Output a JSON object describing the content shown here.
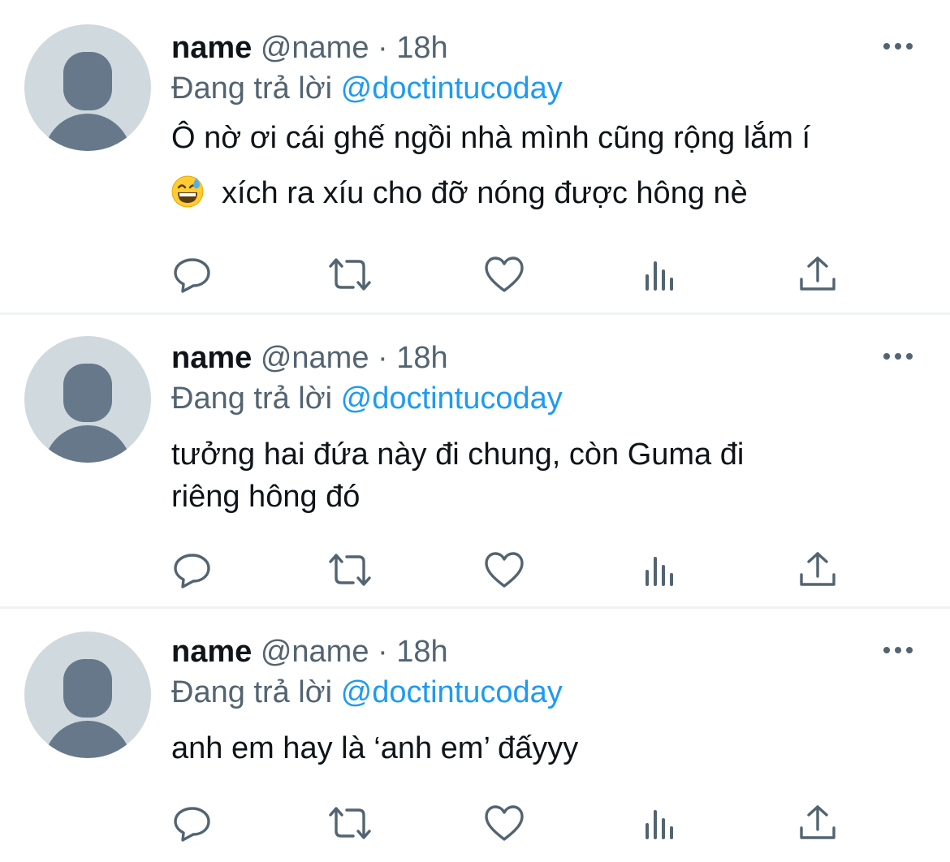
{
  "colors": {
    "text": "#0f1419",
    "secondary": "#536471",
    "mention": "#1d9bf0",
    "avatar_bg": "#cfd9de",
    "avatar_fg": "#66788a",
    "divider": "#eff3f4"
  },
  "icons": {
    "more": "more-icon",
    "reply": "reply-icon",
    "retweet": "retweet-icon",
    "like": "like-icon",
    "views": "views-icon",
    "share": "share-icon"
  },
  "tweets": [
    {
      "name": "name",
      "handle": "@name",
      "separator": "·",
      "time": "18h",
      "reply_label": "Đang trả lời",
      "reply_to": "@doctintucoday",
      "text_line1": "Ô nờ ơi cái ghế ngồi nhà mình cũng rộng lắm í",
      "emoji": "😅",
      "text_line2": "xích ra xíu cho đỡ nóng được hông nè"
    },
    {
      "name": "name",
      "handle": "@name",
      "separator": "·",
      "time": "18h",
      "reply_label": "Đang trả lời",
      "reply_to": "@doctintucoday",
      "text_line1": "tưởng hai đứa này đi chung, còn Guma đi",
      "text_line2": "riêng hông đó"
    },
    {
      "name": "name",
      "handle": "@name",
      "separator": "·",
      "time": "18h",
      "reply_label": "Đang trả lời",
      "reply_to": "@doctintucoday",
      "text_line1": "anh em hay là ‘anh em’ đấyyy"
    }
  ]
}
